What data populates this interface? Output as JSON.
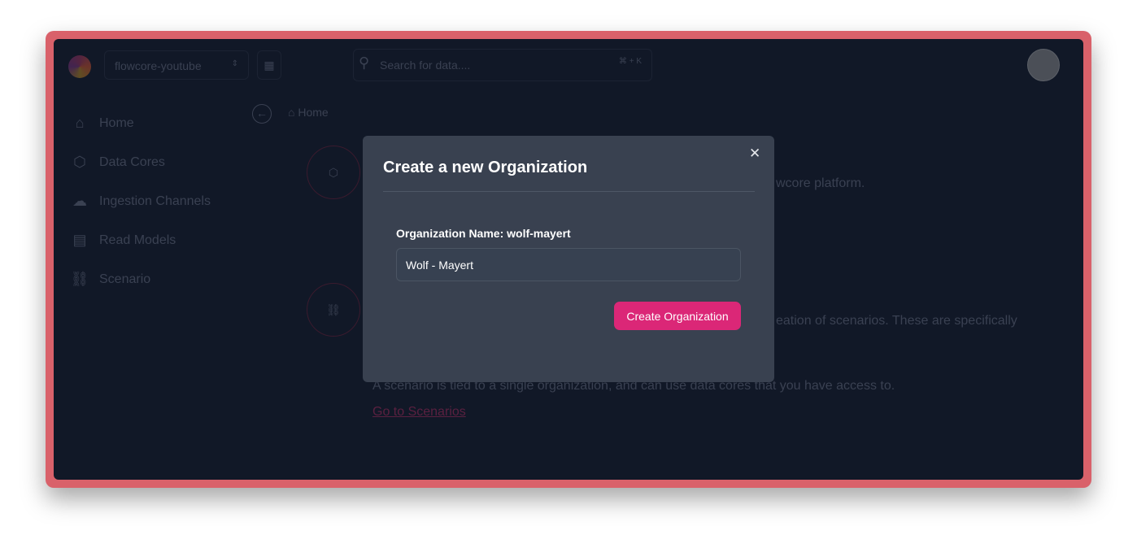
{
  "header": {
    "org_selector": "flowcore-youtube",
    "search_placeholder": "Search for data....",
    "search_shortcut": "⌘ + K"
  },
  "sidebar": {
    "items": [
      {
        "label": "Home",
        "icon": "home-icon"
      },
      {
        "label": "Data Cores",
        "icon": "cubes-icon"
      },
      {
        "label": "Ingestion Channels",
        "icon": "cloud-upload-icon"
      },
      {
        "label": "Read Models",
        "icon": "book-icon"
      },
      {
        "label": "Scenario",
        "icon": "flow-icon"
      }
    ]
  },
  "breadcrumb": {
    "home": "Home"
  },
  "background": {
    "line1": "wcore platform.",
    "line2": "eation of scenarios. These are specifically",
    "line3": "A scenario is tied to a single organization, and can use data cores that you have access to.",
    "link": "Go to Scenarios"
  },
  "modal": {
    "title": "Create a new Organization",
    "label": "Organization Name: wolf-mayert",
    "input_value": "Wolf - Mayert",
    "submit": "Create Organization"
  },
  "colors": {
    "frame": "#d9616a",
    "accent": "#db2777",
    "modal_bg": "#394150",
    "app_bg": "#111827"
  }
}
